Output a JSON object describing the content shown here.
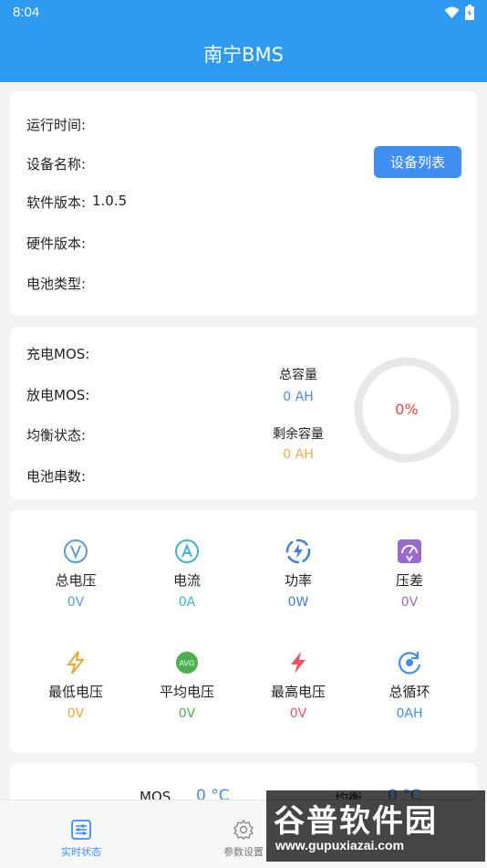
{
  "status_bar": {
    "time": "8:04"
  },
  "app_bar": {
    "title": "南宁BMS"
  },
  "device_info": {
    "runtime_label": "运行时间:",
    "device_name_label": "设备名称:",
    "software_version_label": "软件版本:",
    "software_version_value": "1.0.5",
    "hardware_version_label": "硬件版本:",
    "battery_type_label": "电池类型:",
    "device_list_button": "设备列表"
  },
  "capacity": {
    "charge_mos_label": "充电MOS:",
    "discharge_mos_label": "放电MOS:",
    "balance_status_label": "均衡状态:",
    "battery_series_label": "电池串数:",
    "total_capacity_label": "总容量",
    "total_capacity_value": "0 AH",
    "remaining_capacity_label": "剩余容量",
    "remaining_capacity_value": "0 AH",
    "gauge_percent": "0%"
  },
  "metrics": [
    {
      "label": "总电压",
      "value": "0V",
      "icon": "voltage-icon",
      "color": "#5b9bd5"
    },
    {
      "label": "电流",
      "value": "0A",
      "icon": "current-icon",
      "color": "#3fb4c6"
    },
    {
      "label": "功率",
      "value": "0W",
      "icon": "power-icon",
      "color": "#3f7fe0"
    },
    {
      "label": "压差",
      "value": "0V",
      "icon": "voltage-diff-icon",
      "color": "#9b6ad0"
    },
    {
      "label": "最低电压",
      "value": "0V",
      "icon": "min-voltage-icon",
      "color": "#e9a535"
    },
    {
      "label": "平均电压",
      "value": "0V",
      "icon": "avg-voltage-icon",
      "color": "#4caf50"
    },
    {
      "label": "最高电压",
      "value": "0V",
      "icon": "max-voltage-icon",
      "color": "#ef5366"
    },
    {
      "label": "总循环",
      "value": "0AH",
      "icon": "cycle-icon",
      "color": "#3f8ef2"
    }
  ],
  "temperature": {
    "mos_label": "MOS",
    "mos_value": "0 °C",
    "balance_label": "均衡",
    "balance_value": "0 °C"
  },
  "tabs": [
    {
      "label": "实时状态",
      "icon": "realtime-status-icon"
    },
    {
      "label": "参数设置",
      "icon": "settings-gear-icon"
    }
  ],
  "watermark": {
    "title": "谷普软件园",
    "url": "www.gupuxiazai.com"
  }
}
